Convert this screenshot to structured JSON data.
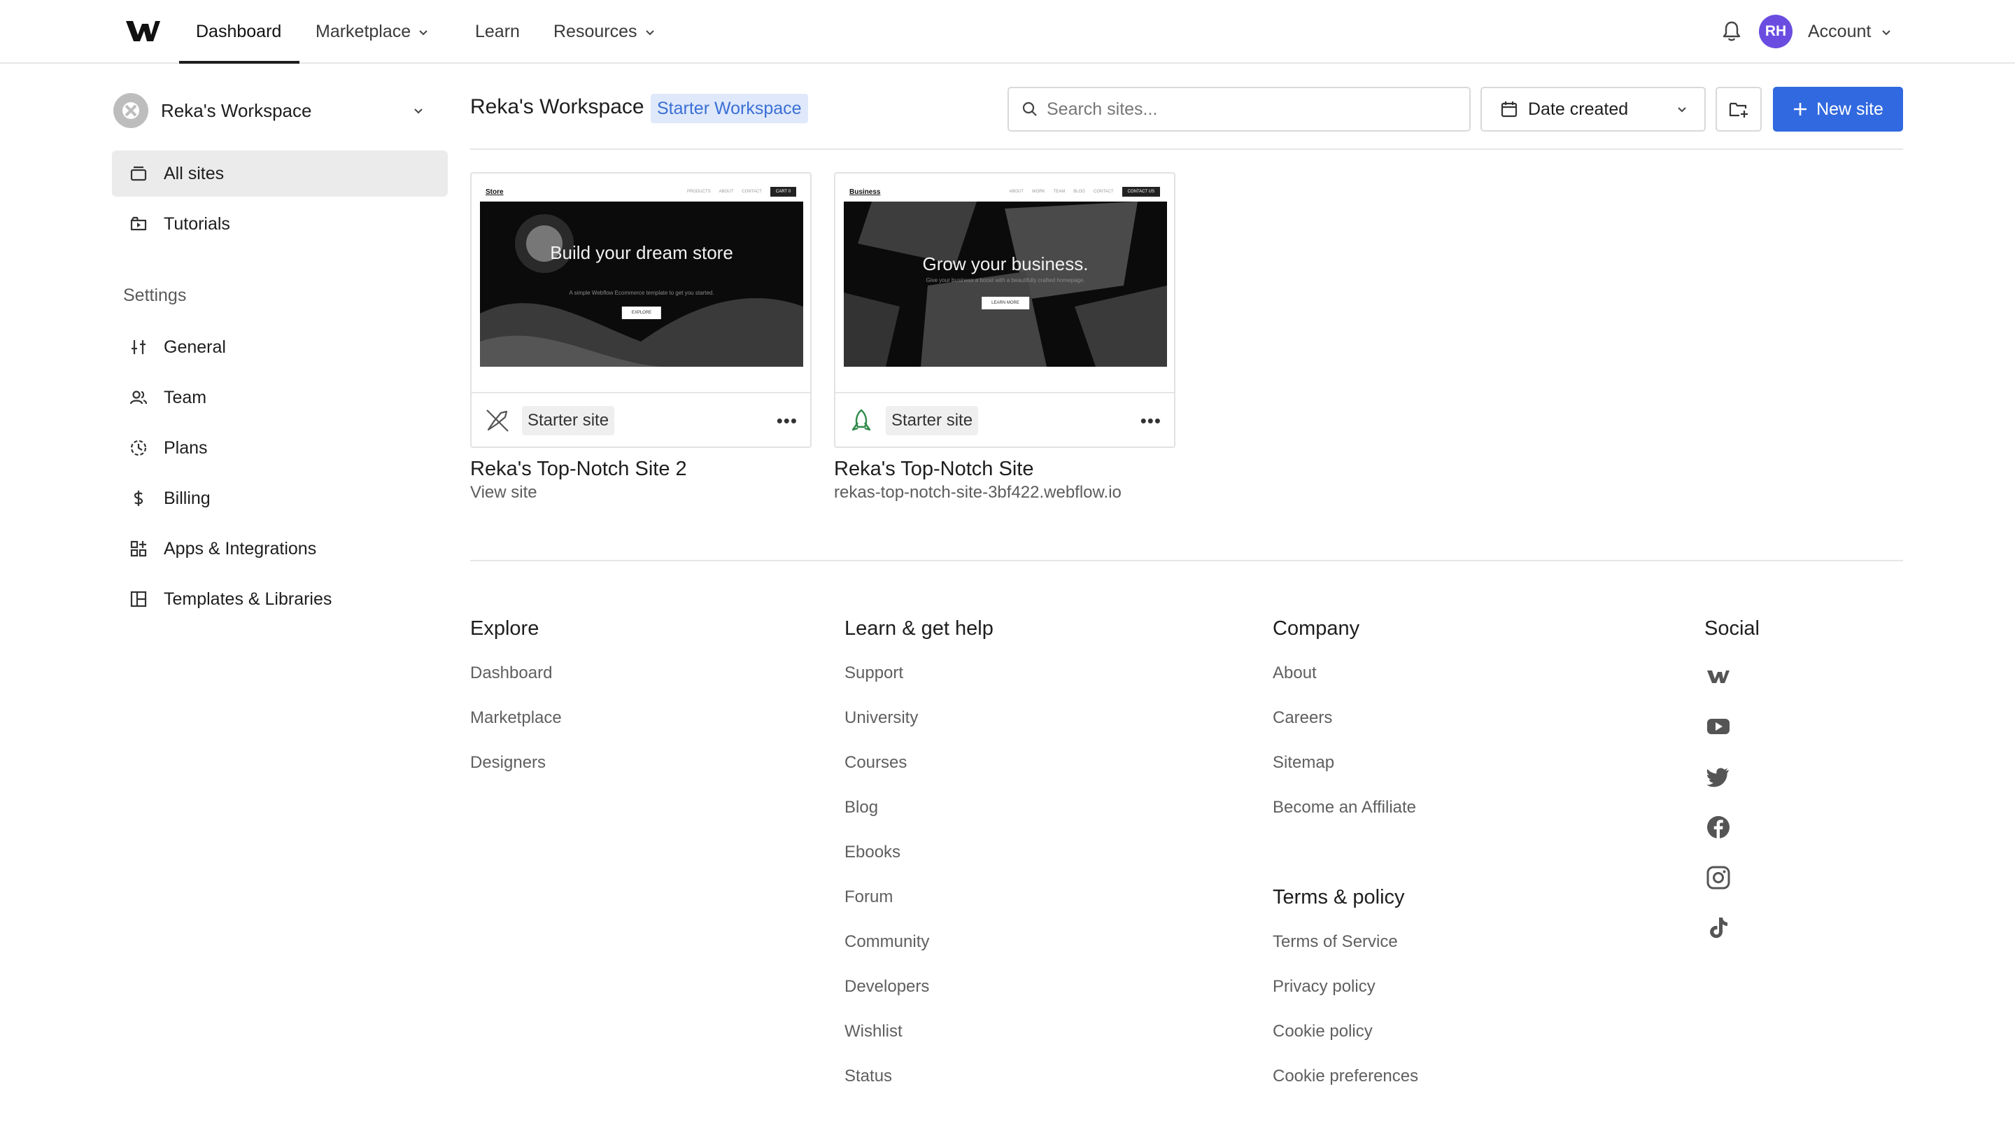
{
  "nav": {
    "dashboard": "Dashboard",
    "marketplace": "Marketplace",
    "learn": "Learn",
    "resources": "Resources",
    "avatar_initials": "RH",
    "account": "Account"
  },
  "sidebar": {
    "workspace_name": "Reka's Workspace",
    "items": [
      {
        "label": "All sites",
        "icon": "sites-icon"
      },
      {
        "label": "Tutorials",
        "icon": "tutorials-icon"
      }
    ],
    "settings_heading": "Settings",
    "settings_items": [
      {
        "label": "General",
        "icon": "sliders-icon"
      },
      {
        "label": "Team",
        "icon": "team-icon"
      },
      {
        "label": "Plans",
        "icon": "plans-icon"
      },
      {
        "label": "Billing",
        "icon": "dollar-icon"
      },
      {
        "label": "Apps & Integrations",
        "icon": "apps-icon"
      },
      {
        "label": "Templates & Libraries",
        "icon": "templates-icon"
      }
    ]
  },
  "header": {
    "title": "Reka's Workspace",
    "badge": "Starter Workspace",
    "search_placeholder": "Search sites...",
    "sort_label": "Date created",
    "new_site_label": "New site"
  },
  "sites": [
    {
      "name": "Reka's Top-Notch Site 2",
      "sub": "View site",
      "plan": "Starter site",
      "thumb": {
        "brand": "Store",
        "links": [
          "PRODUCTS",
          "ABOUT",
          "CONTACT"
        ],
        "cta": "CART 0",
        "hero_title": "Build your dream store",
        "hero_sub": "A simple Webflow Ecommerce template to get you started.",
        "hero_button": "EXPLORE"
      }
    },
    {
      "name": "Reka's Top-Notch Site",
      "sub": "rekas-top-notch-site-3bf422.webflow.io",
      "plan": "Starter site",
      "thumb": {
        "brand": "Business",
        "links": [
          "ABOUT",
          "WORK",
          "TEAM",
          "BLOG",
          "CONTACT"
        ],
        "cta": "CONTACT US",
        "hero_title": "Grow your business.",
        "hero_sub": "Give your business a boost with a beautifully crafted homepage.",
        "hero_button": "LEARN MORE"
      }
    }
  ],
  "footer": {
    "explore": {
      "title": "Explore",
      "links": [
        "Dashboard",
        "Marketplace",
        "Designers"
      ]
    },
    "learn": {
      "title": "Learn & get help",
      "links": [
        "Support",
        "University",
        "Courses",
        "Blog",
        "Ebooks",
        "Forum",
        "Community",
        "Developers",
        "Wishlist",
        "Status"
      ]
    },
    "company": {
      "title": "Company",
      "links": [
        "About",
        "Careers",
        "Sitemap",
        "Become an Affiliate"
      ]
    },
    "terms": {
      "title": "Terms & policy",
      "links": [
        "Terms of Service",
        "Privacy policy",
        "Cookie policy",
        "Cookie preferences"
      ]
    },
    "social": {
      "title": "Social",
      "icons": [
        "webflow-icon",
        "youtube-icon",
        "twitter-icon",
        "facebook-icon",
        "instagram-icon",
        "tiktok-icon"
      ]
    }
  },
  "colors": {
    "accent": "#3169e0",
    "avatar": "#6a4de0",
    "badge_bg": "#dfe9fb",
    "badge_text": "#3b6fd6"
  }
}
